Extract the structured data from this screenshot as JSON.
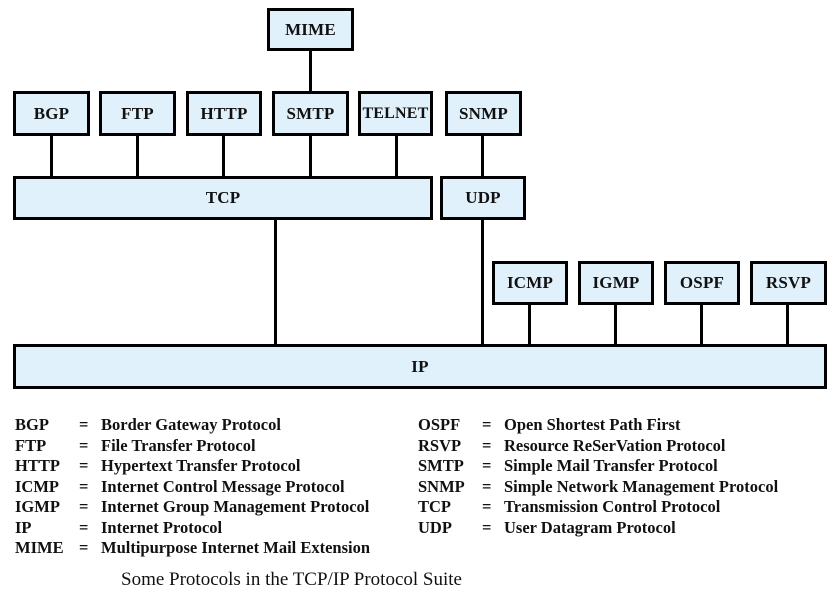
{
  "diagram": {
    "title": "Some Protocols in the TCP/IP Protocol Suite",
    "colors": {
      "box_fill": "#e0f1fb",
      "border": "#000000"
    },
    "nodes": {
      "mime": "MIME",
      "bgp": "BGP",
      "ftp": "FTP",
      "http": "HTTP",
      "smtp": "SMTP",
      "telnet": "TELNET",
      "snmp": "SNMP",
      "tcp": "TCP",
      "udp": "UDP",
      "icmp": "ICMP",
      "igmp": "IGMP",
      "ospf": "OSPF",
      "rsvp": "RSVP",
      "ip": "IP"
    },
    "edges": [
      [
        "MIME",
        "SMTP"
      ],
      [
        "BGP",
        "TCP"
      ],
      [
        "FTP",
        "TCP"
      ],
      [
        "HTTP",
        "TCP"
      ],
      [
        "SMTP",
        "TCP"
      ],
      [
        "TELNET",
        "TCP"
      ],
      [
        "SNMP",
        "UDP"
      ],
      [
        "TCP",
        "IP"
      ],
      [
        "UDP",
        "IP"
      ],
      [
        "ICMP",
        "IP"
      ],
      [
        "IGMP",
        "IP"
      ],
      [
        "OSPF",
        "IP"
      ],
      [
        "RSVP",
        "IP"
      ]
    ]
  },
  "legend": {
    "left": [
      {
        "abbr": "BGP",
        "eq": "=",
        "full": "Border Gateway Protocol"
      },
      {
        "abbr": "FTP",
        "eq": "=",
        "full": "File Transfer Protocol"
      },
      {
        "abbr": "HTTP",
        "eq": "=",
        "full": "Hypertext Transfer Protocol"
      },
      {
        "abbr": "ICMP",
        "eq": "=",
        "full": "Internet Control Message Protocol"
      },
      {
        "abbr": "IGMP",
        "eq": "=",
        "full": "Internet Group Management Protocol"
      },
      {
        "abbr": "IP",
        "eq": "=",
        "full": "Internet Protocol"
      },
      {
        "abbr": "MIME",
        "eq": "=",
        "full": "Multipurpose Internet Mail Extension"
      }
    ],
    "right": [
      {
        "abbr": "OSPF",
        "eq": "=",
        "full": "Open Shortest Path First"
      },
      {
        "abbr": "RSVP",
        "eq": "=",
        "full": "Resource ReSerVation Protocol"
      },
      {
        "abbr": "SMTP",
        "eq": "=",
        "full": "Simple Mail Transfer Protocol"
      },
      {
        "abbr": "SNMP",
        "eq": "=",
        "full": "Simple Network Management Protocol"
      },
      {
        "abbr": "TCP",
        "eq": "=",
        "full": "Transmission Control Protocol"
      },
      {
        "abbr": "UDP",
        "eq": "=",
        "full": "User Datagram Protocol"
      }
    ]
  }
}
